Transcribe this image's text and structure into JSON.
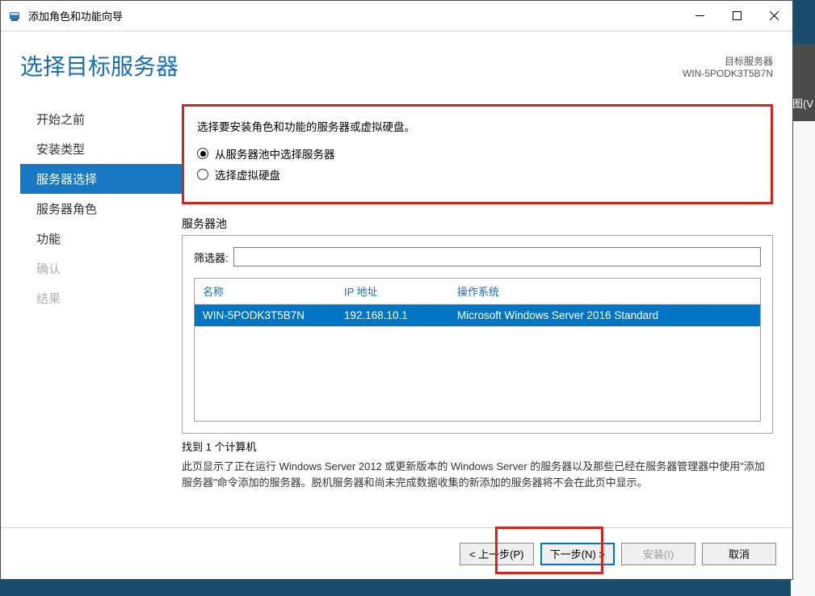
{
  "backdrop": {
    "tab_partial": "图(V"
  },
  "window": {
    "title": "添加角色和功能向导"
  },
  "header": {
    "page_title": "选择目标服务器",
    "target_label": "目标服务器",
    "target_name": "WIN-5PODK3T5B7N"
  },
  "sidebar": {
    "items": [
      {
        "label": "开始之前",
        "state": "normal"
      },
      {
        "label": "安装类型",
        "state": "normal"
      },
      {
        "label": "服务器选择",
        "state": "active"
      },
      {
        "label": "服务器角色",
        "state": "normal"
      },
      {
        "label": "功能",
        "state": "normal"
      },
      {
        "label": "确认",
        "state": "disabled"
      },
      {
        "label": "结果",
        "state": "disabled"
      }
    ]
  },
  "content": {
    "instruction": "选择要安装角色和功能的服务器或虚拟硬盘。",
    "radio1": "从服务器池中选择服务器",
    "radio2": "选择虚拟硬盘",
    "pool_label": "服务器池",
    "filter_label": "筛选器:",
    "filter_value": "",
    "columns": {
      "name": "名称",
      "ip": "IP 地址",
      "os": "操作系统"
    },
    "rows": [
      {
        "name": "WIN-5PODK3T5B7N",
        "ip": "192.168.10.1",
        "os": "Microsoft Windows Server 2016 Standard"
      }
    ],
    "found_text": "找到 1 个计算机",
    "description": "此页显示了正在运行 Windows Server 2012 或更新版本的 Windows Server 的服务器以及那些已经在服务器管理器中使用\"添加服务器\"命令添加的服务器。脱机服务器和尚未完成数据收集的新添加的服务器将不会在此页中显示。"
  },
  "footer": {
    "prev": "< 上一步(P)",
    "next": "下一步(N) >",
    "install": "安装(I)",
    "cancel": "取消"
  }
}
